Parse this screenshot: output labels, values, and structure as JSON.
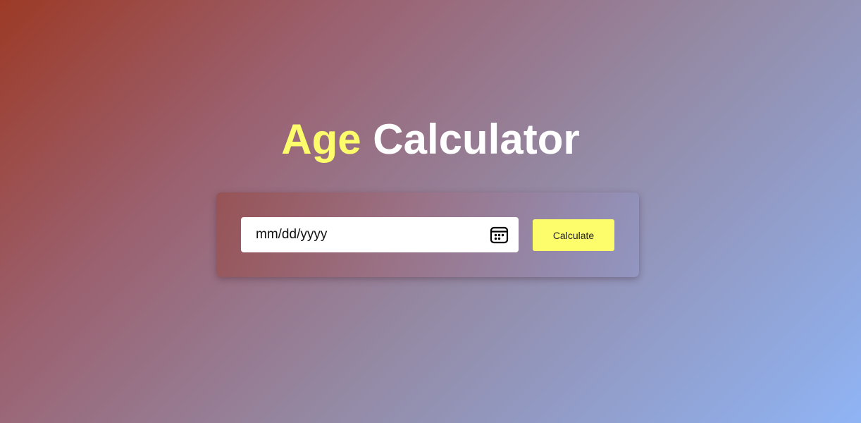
{
  "header": {
    "title_accent": "Age",
    "title_rest": "Calculator"
  },
  "form": {
    "date_placeholder": "mm/dd/yyyy",
    "date_value": "",
    "calendar_icon": "calendar-icon",
    "calculate_label": "Calculate"
  },
  "colors": {
    "accent": "#fdfd6b",
    "title_text": "#ffffff",
    "gradient_start": "#9c3a26",
    "gradient_end": "#8fb4f5"
  }
}
